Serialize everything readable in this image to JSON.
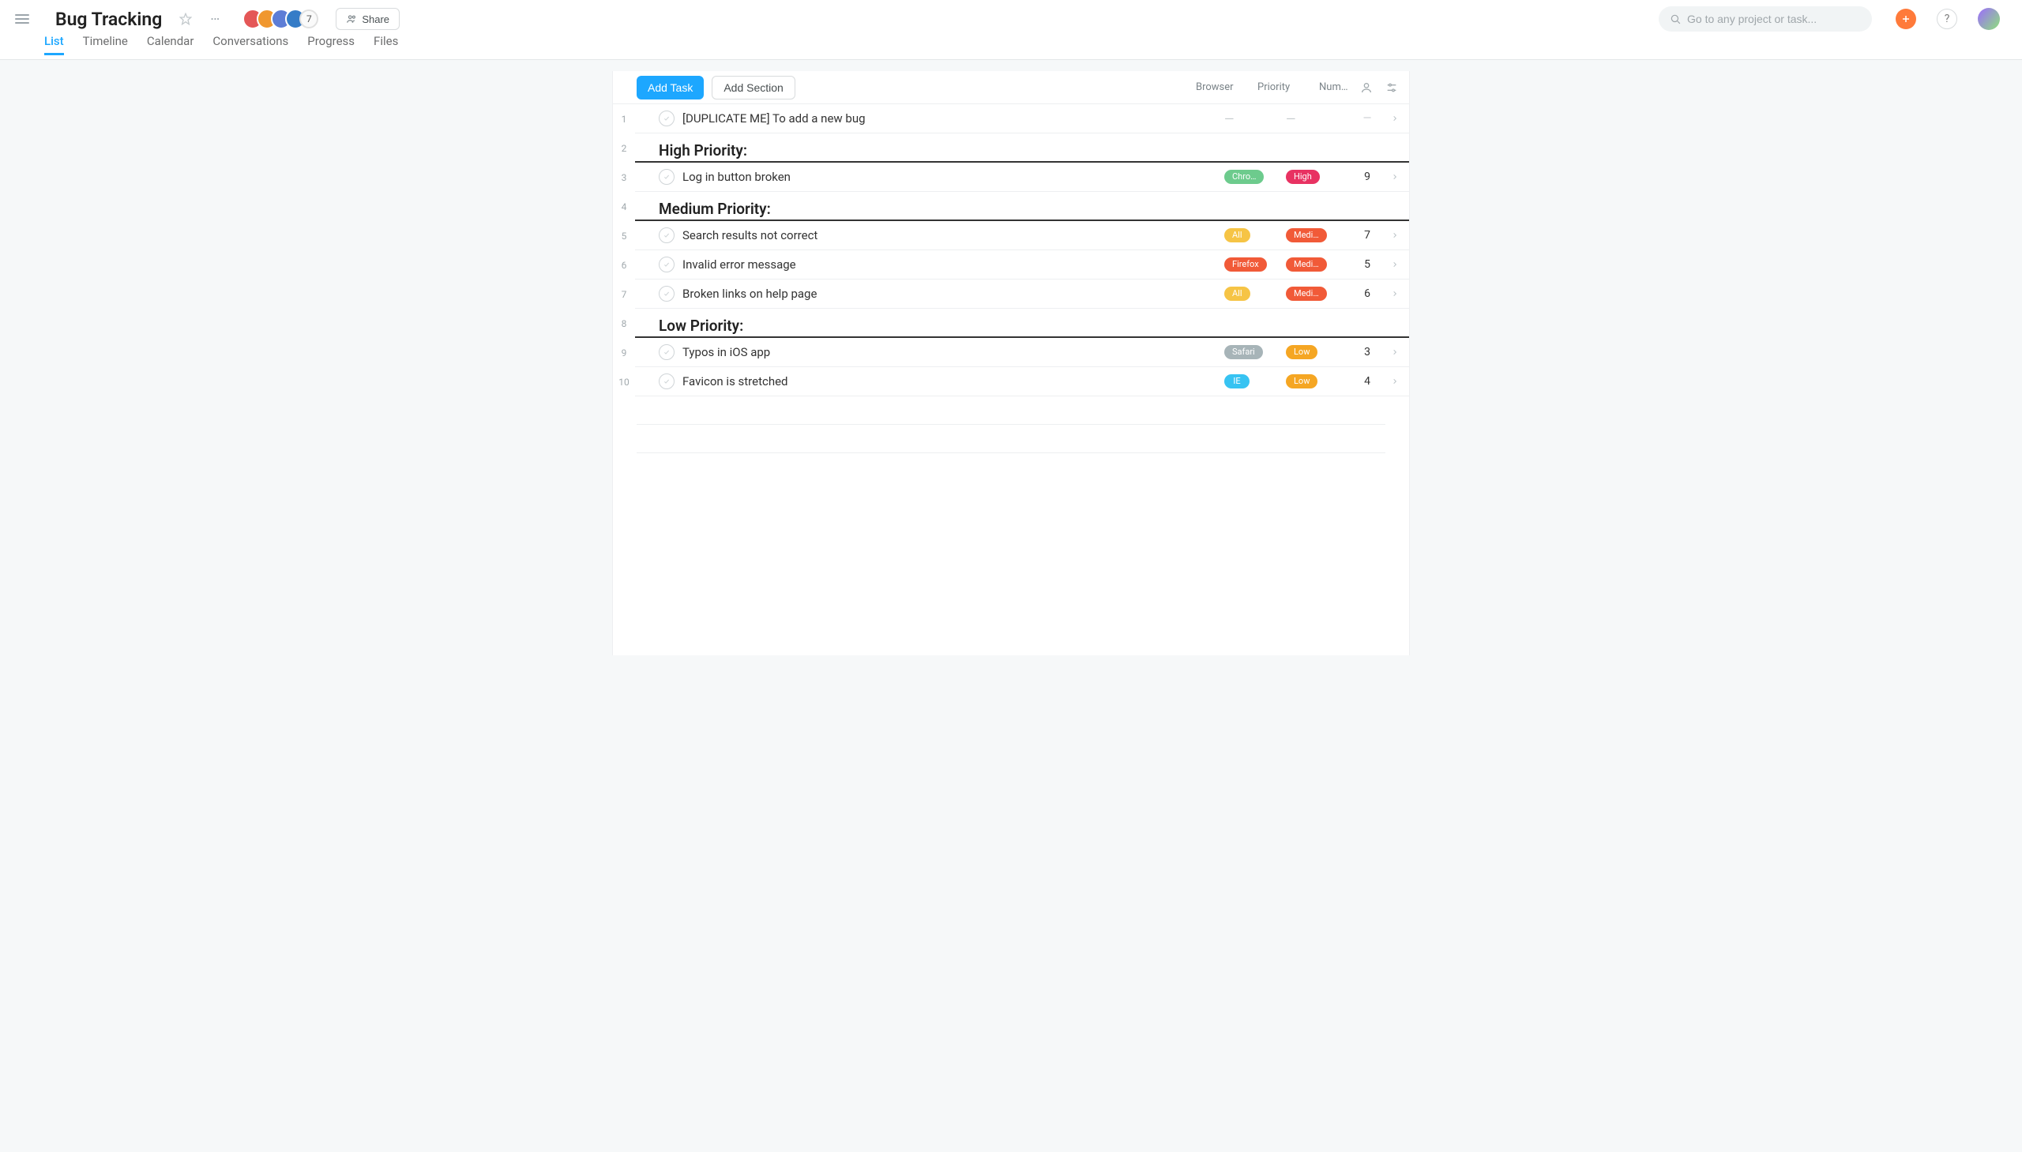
{
  "project": {
    "title": "Bug Tracking",
    "member_count": 7,
    "share_label": "Share"
  },
  "search": {
    "placeholder": "Go to any project or task..."
  },
  "tabs": [
    {
      "label": "List",
      "active": true
    },
    {
      "label": "Timeline",
      "active": false
    },
    {
      "label": "Calendar",
      "active": false
    },
    {
      "label": "Conversations",
      "active": false
    },
    {
      "label": "Progress",
      "active": false
    },
    {
      "label": "Files",
      "active": false
    }
  ],
  "buttons": {
    "add_task": "Add Task",
    "add_section": "Add Section"
  },
  "columns": [
    {
      "label": "Browser"
    },
    {
      "label": "Priority"
    },
    {
      "label": "Num…"
    }
  ],
  "rows": [
    {
      "num": 1,
      "type": "task",
      "title": "[DUPLICATE ME] To add a new bug",
      "browser": null,
      "browser_color": null,
      "priority": null,
      "priority_color": null,
      "count": null
    },
    {
      "num": 2,
      "type": "section",
      "title": "High Priority:"
    },
    {
      "num": 3,
      "type": "task",
      "title": "Log in button broken",
      "browser": "Chro…",
      "browser_color": "green",
      "priority": "High",
      "priority_color": "pink",
      "count": 9
    },
    {
      "num": 4,
      "type": "section",
      "title": "Medium Priority:"
    },
    {
      "num": 5,
      "type": "task",
      "title": "Search results not correct",
      "browser": "All",
      "browser_color": "yellow",
      "priority": "Medi…",
      "priority_color": "red",
      "count": 7
    },
    {
      "num": 6,
      "type": "task",
      "title": "Invalid error message",
      "browser": "Firefox",
      "browser_color": "red",
      "priority": "Medi…",
      "priority_color": "red",
      "count": 5
    },
    {
      "num": 7,
      "type": "task",
      "title": "Broken links on help page",
      "browser": "All",
      "browser_color": "yellow",
      "priority": "Medi…",
      "priority_color": "red",
      "count": 6
    },
    {
      "num": 8,
      "type": "section",
      "title": "Low Priority:"
    },
    {
      "num": 9,
      "type": "task",
      "title": "Typos in iOS app",
      "browser": "Safari",
      "browser_color": "gray",
      "priority": "Low",
      "priority_color": "orange",
      "count": 3
    },
    {
      "num": 10,
      "type": "task",
      "title": "Favicon is stretched",
      "browser": "IE",
      "browser_color": "blue",
      "priority": "Low",
      "priority_color": "orange",
      "count": 4
    }
  ],
  "avatar_colors": [
    "#e45757",
    "#f0972e",
    "#5d7dd6",
    "#357cc7"
  ]
}
